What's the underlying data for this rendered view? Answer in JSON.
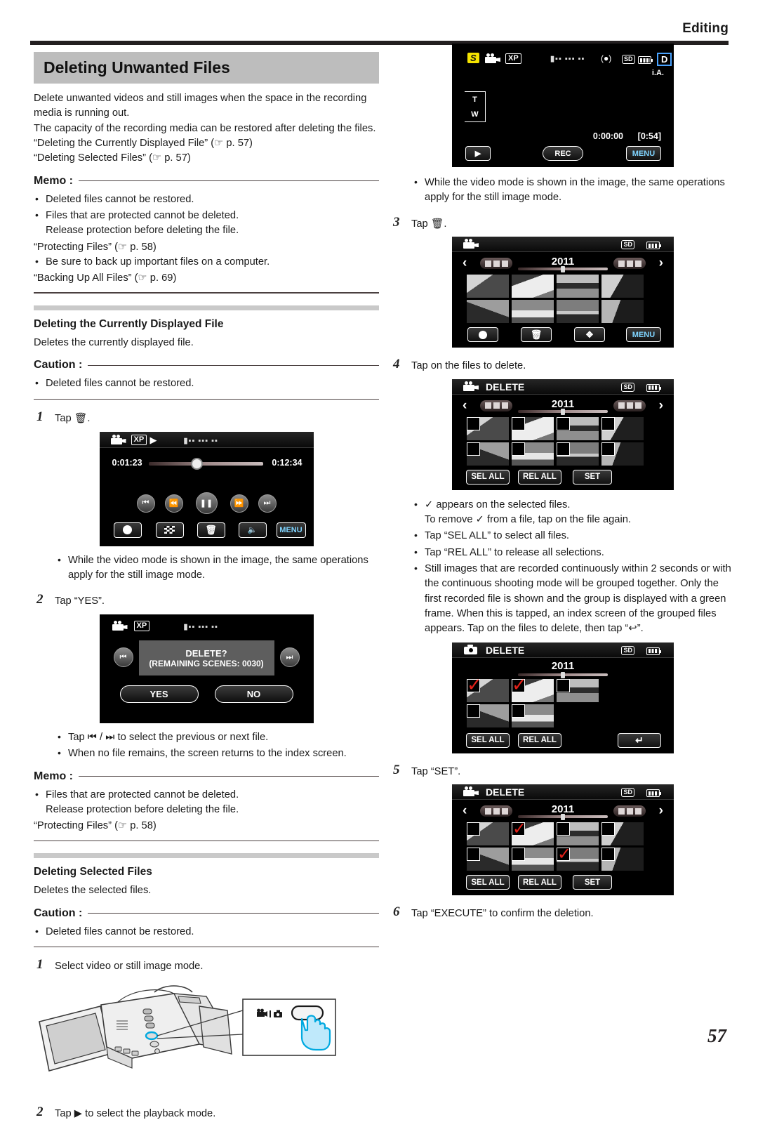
{
  "header": {
    "section": "Editing",
    "page_number": "57"
  },
  "left": {
    "title": "Deleting Unwanted Files",
    "intro_1": "Delete unwanted videos and still images when the space in the recording media is running out.",
    "intro_2": "The capacity of the recording media can be restored after deleting the files.",
    "ref_1": "“Deleting the Currently Displayed File” (☞ p. 57)",
    "ref_2": "“Deleting Selected Files” (☞ p. 57)",
    "memo_label_1": "Memo :",
    "memo_1_items": [
      "Deleted files cannot be restored.",
      "Files that are protected cannot be deleted.",
      "Be sure to back up important files on a computer."
    ],
    "memo_1_sub": "Release protection before deleting the file.",
    "memo_1_ref_a": "“Protecting Files” (☞ p. 58)",
    "memo_1_ref_b": "“Backing Up All Files” (☞ p. 69)",
    "section_a_head": "Deleting the Currently Displayed File",
    "section_a_desc": "Deletes the currently displayed file.",
    "caution_label_1": "Caution :",
    "caution_1_item": "Deleted files cannot be restored.",
    "step1_num": "1",
    "step1_text": "Tap 🗑.",
    "note_after_step1": "While the video mode is shown in the image, the same operations apply for the still image mode.",
    "step2_num": "2",
    "step2_text": "Tap “YES”.",
    "note_after_step2_a": "Tap ⏮ / ⏭ to select the previous or next file.",
    "note_after_step2_b": "When no file remains, the screen returns to the index screen.",
    "memo_label_2": "Memo :",
    "memo_2_item": "Files that are protected cannot be deleted.",
    "memo_2_sub": "Release protection before deleting the file.",
    "memo_2_ref": "“Protecting Files” (☞ p. 58)",
    "section_b_head": "Deleting Selected Files",
    "section_b_desc": "Deletes the selected files.",
    "caution_label_2": "Caution :",
    "caution_2_item": "Deleted files cannot be restored.",
    "step_b1_num": "1",
    "step_b1_text": "Select video or still image mode.",
    "step_b2_num": "2",
    "step_b2_text": "Tap ▶ to select the playback mode."
  },
  "right": {
    "note_after_rec": "While the video mode is shown in the image, the same operations apply for the still image mode.",
    "step3_num": "3",
    "step3_text": "Tap 🗑.",
    "step4_num": "4",
    "step4_text": "Tap on the files to delete.",
    "step4_notes": [
      "✓ appears on the selected files.",
      "Tap “SEL ALL” to select all files.",
      "Tap “REL ALL” to release all selections.",
      "Still images that are recorded continuously within 2 seconds or with the continuous shooting mode will be grouped together. Only the first recorded file is shown and the group is displayed with a green frame. When this is tapped, an index screen of the grouped files appears. Tap on the files to delete, then tap “↩”."
    ],
    "step4_note_sub": "To remove ✓ from a file, tap on the file again.",
    "step5_num": "5",
    "step5_text": "Tap “SET”.",
    "step6_num": "6",
    "step6_text": "Tap “EXECUTE” to confirm the deletion."
  },
  "screens": {
    "playback": {
      "name": "video-playback-screen",
      "mode_icon": "video-camera-icon",
      "quality": "XP",
      "play_icon": "play-icon",
      "time_elapsed": "0:01:23",
      "time_total": "0:12:34",
      "transport": [
        "prev-icon",
        "rewind-icon",
        "pause-icon",
        "forward-icon",
        "next-icon"
      ],
      "buttons": [
        "record-mode-button",
        "index-button",
        "delete-button",
        "volume-button",
        "MENU"
      ]
    },
    "confirm": {
      "name": "delete-confirm-screen",
      "mode_icon": "video-camera-icon",
      "quality": "XP",
      "message_line1": "DELETE?",
      "message_line2": "(REMAINING SCENES: 0030)",
      "yes_label": "YES",
      "no_label": "NO",
      "prev_icon": "prev-icon",
      "next_icon": "next-icon"
    },
    "record": {
      "name": "recording-standby-screen",
      "badge_s": "S",
      "mode_icon": "video-camera-icon",
      "quality": "XP",
      "stabilizer_icon": "image-stabilizer-icon",
      "media": "SD",
      "battery_icon": "battery-icon",
      "badge_d": "D",
      "ia_label": "i.A.",
      "zoom_tele": "T",
      "zoom_wide": "W",
      "counter": "0:00:00",
      "remaining": "[0:54]",
      "play_button": "playback-mode-button",
      "rec_label": "REC",
      "menu_label": "MENU"
    },
    "index": {
      "name": "index-screen",
      "mode_icon": "video-camera-icon",
      "media": "SD",
      "battery_icon": "battery-icon",
      "year": "2011",
      "prev_arrow": "‹",
      "next_arrow": "›",
      "buttons": [
        "record-mode-button",
        "delete-button",
        "media-button",
        "MENU"
      ]
    },
    "delete_select": {
      "name": "delete-select-screen",
      "mode_icon": "video-camera-icon",
      "title": "DELETE",
      "media": "SD",
      "battery_icon": "battery-icon",
      "year": "2011",
      "sel_all": "SEL ALL",
      "rel_all": "REL ALL",
      "set": "SET",
      "checked": []
    },
    "delete_group": {
      "name": "delete-group-screen",
      "mode_icon": "still-camera-icon",
      "title": "DELETE",
      "media": "SD",
      "battery_icon": "battery-icon",
      "year": "2011",
      "sel_all": "SEL ALL",
      "rel_all": "REL ALL",
      "back_icon": "return-arrow-icon",
      "checked": [
        0,
        1
      ]
    },
    "delete_checked": {
      "name": "delete-selected-screen",
      "mode_icon": "video-camera-icon",
      "title": "DELETE",
      "media": "SD",
      "battery_icon": "battery-icon",
      "year": "2011",
      "sel_all": "SEL ALL",
      "rel_all": "REL ALL",
      "set": "SET",
      "checked": [
        1,
        6
      ]
    }
  },
  "illustration": {
    "name": "camcorder-mode-button-illustration",
    "video_icon": "video-camera-icon",
    "still_icon": "still-camera-icon",
    "hand_icon": "pointing-hand-icon"
  }
}
